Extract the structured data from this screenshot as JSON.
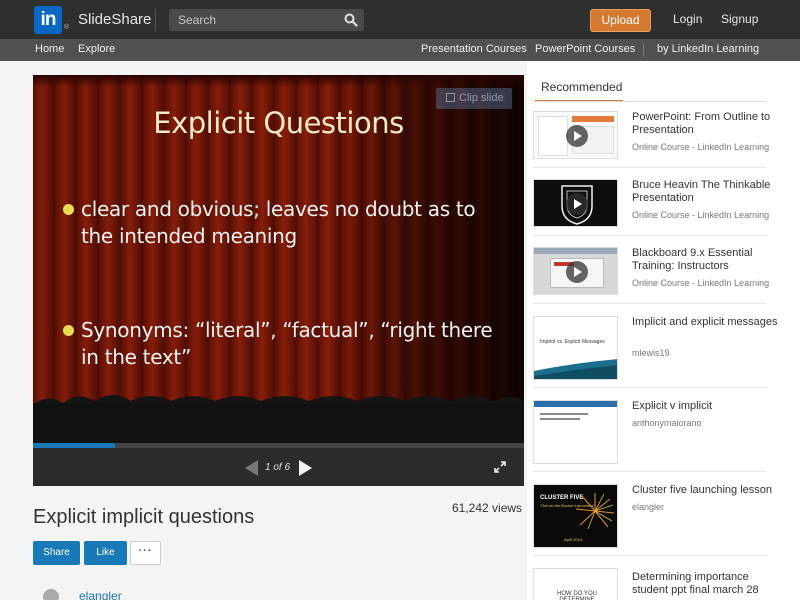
{
  "header": {
    "logo": "in",
    "brand": "SlideShare",
    "search_placeholder": "Search",
    "upload_label": "Upload",
    "login_label": "Login",
    "signup_label": "Signup"
  },
  "nav": {
    "home": "Home",
    "explore": "Explore",
    "presentation_courses": "Presentation Courses",
    "powerpoint_courses": "PowerPoint Courses",
    "by_linkedin": "by LinkedIn Learning"
  },
  "player": {
    "clip_label": "Clip slide",
    "slide_title": "Explicit Questions",
    "bullets": [
      {
        "line1": "clear and obvious; leaves no doubt as to",
        "line2": "the intended meaning"
      },
      {
        "line1": "Synonyms:  “literal”, “factual”, “right there",
        "line2": "in the text”"
      }
    ],
    "page_indicator": "1 of 6",
    "progress": 0.167
  },
  "document": {
    "title": "Explicit implicit questions",
    "views": "61,242 views",
    "share_label": "Share",
    "like_label": "Like",
    "more_label": "···",
    "author": "elangler"
  },
  "sidebar": {
    "tab_label": "Recommended",
    "items": [
      {
        "title": "PowerPoint: From Outline to Presentation",
        "subtitle": "Online Course - LinkedIn Learning"
      },
      {
        "title": "Bruce Heavin The Thinkable Presentation",
        "subtitle": "Online Course - LinkedIn Learning"
      },
      {
        "title": "Blackboard 9.x Essential Training: Instructors",
        "subtitle": "Online Course - LinkedIn Learning"
      },
      {
        "title": "Implicit and explicit messages",
        "subtitle": "mlewis19"
      },
      {
        "title": "Explicit v implicit",
        "subtitle": "anthonymaiorano"
      },
      {
        "title": "Cluster five launching lesson",
        "subtitle": "elangler"
      },
      {
        "title": "Determining importance student ppt final march 28",
        "subtitle": ""
      }
    ],
    "thumb_texts": {
      "implicit_thumb": "Implicit vs. Explicit Messages",
      "cluster_thumb_title": "CLUSTER FIVE",
      "cluster_thumb_sub": "“Get on the Rocket Launchers”",
      "cluster_thumb_date": "April 2013",
      "determining_thumb": "HOW DO YOU DETERMINE"
    }
  },
  "colors": {
    "accent_orange": "#d47a30",
    "link_blue": "#1979b8",
    "topbar": "#2f2f2f",
    "navbar": "#505050"
  }
}
